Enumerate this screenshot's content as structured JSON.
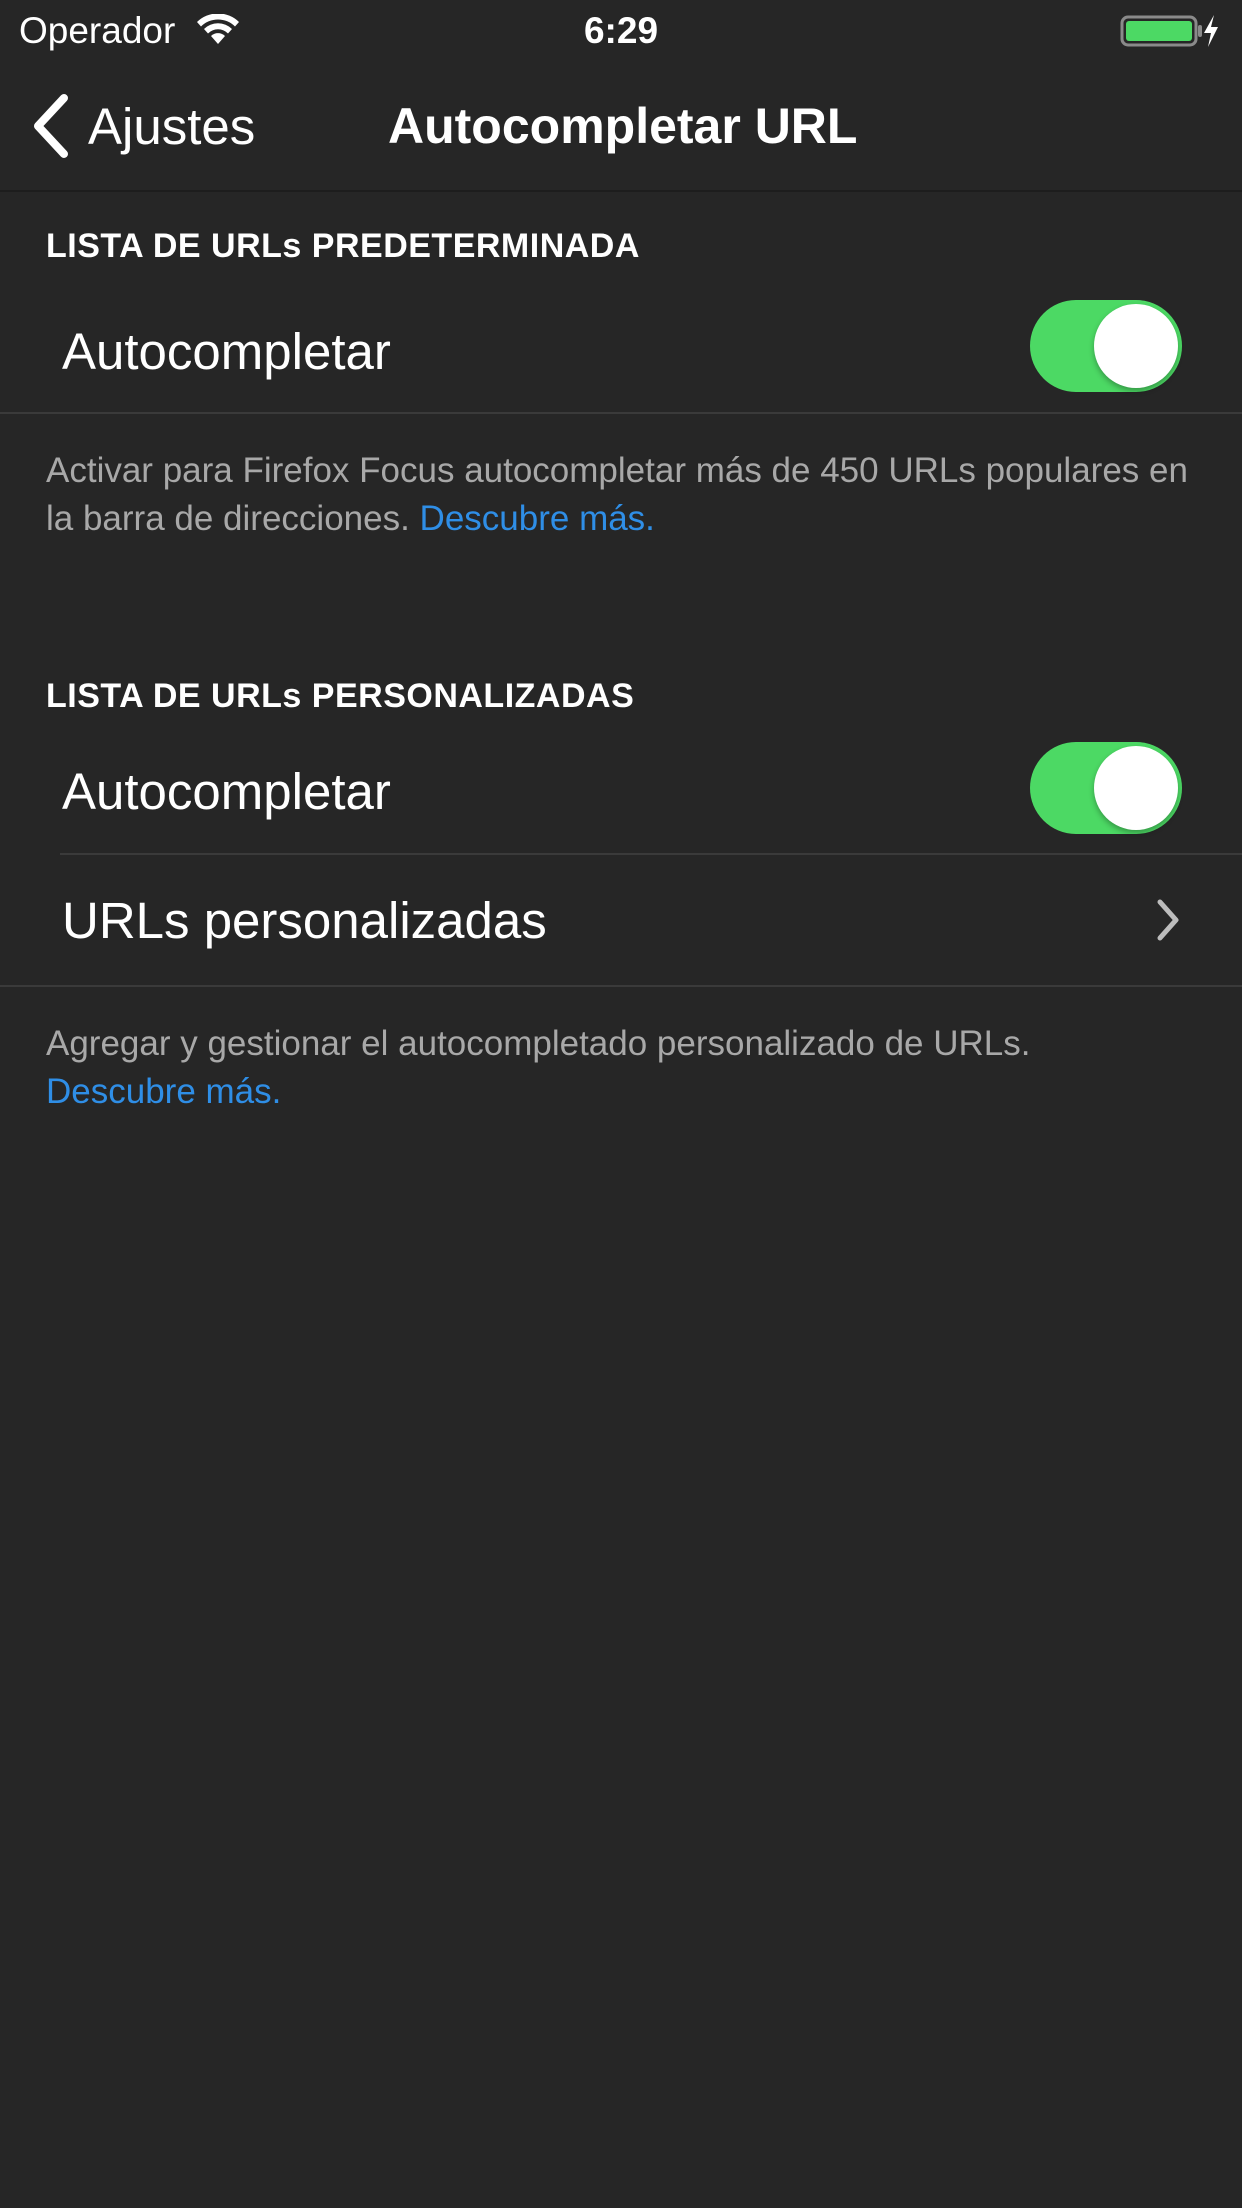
{
  "status_bar": {
    "carrier": "Operador",
    "time": "6:29",
    "battery_color": "#4cd964"
  },
  "nav": {
    "back_label": "Ajustes",
    "title": "Autocompletar URL"
  },
  "sections": [
    {
      "header": "LISTA DE URLs PREDETERMINADA",
      "rows": [
        {
          "label": "Autocompletar",
          "type": "toggle",
          "on": true
        }
      ],
      "footer_text": "Activar para Firefox Focus autocompletar más de 450 URLs populares en la barra de direcciones.",
      "footer_link": "Descubre más."
    },
    {
      "header": "LISTA DE URLs PERSONALIZADAS",
      "rows": [
        {
          "label": "Autocompletar",
          "type": "toggle",
          "on": true
        },
        {
          "label": "URLs personalizadas",
          "type": "disclosure",
          "icon": "chevron-right-icon"
        }
      ],
      "footer_text": "Agregar y gestionar el autocompletado personalizado de URLs.",
      "footer_link": "Descubre más."
    }
  ],
  "colors": {
    "background": "#262626",
    "toggle_on": "#4cd964",
    "link": "#2f8ee6"
  }
}
